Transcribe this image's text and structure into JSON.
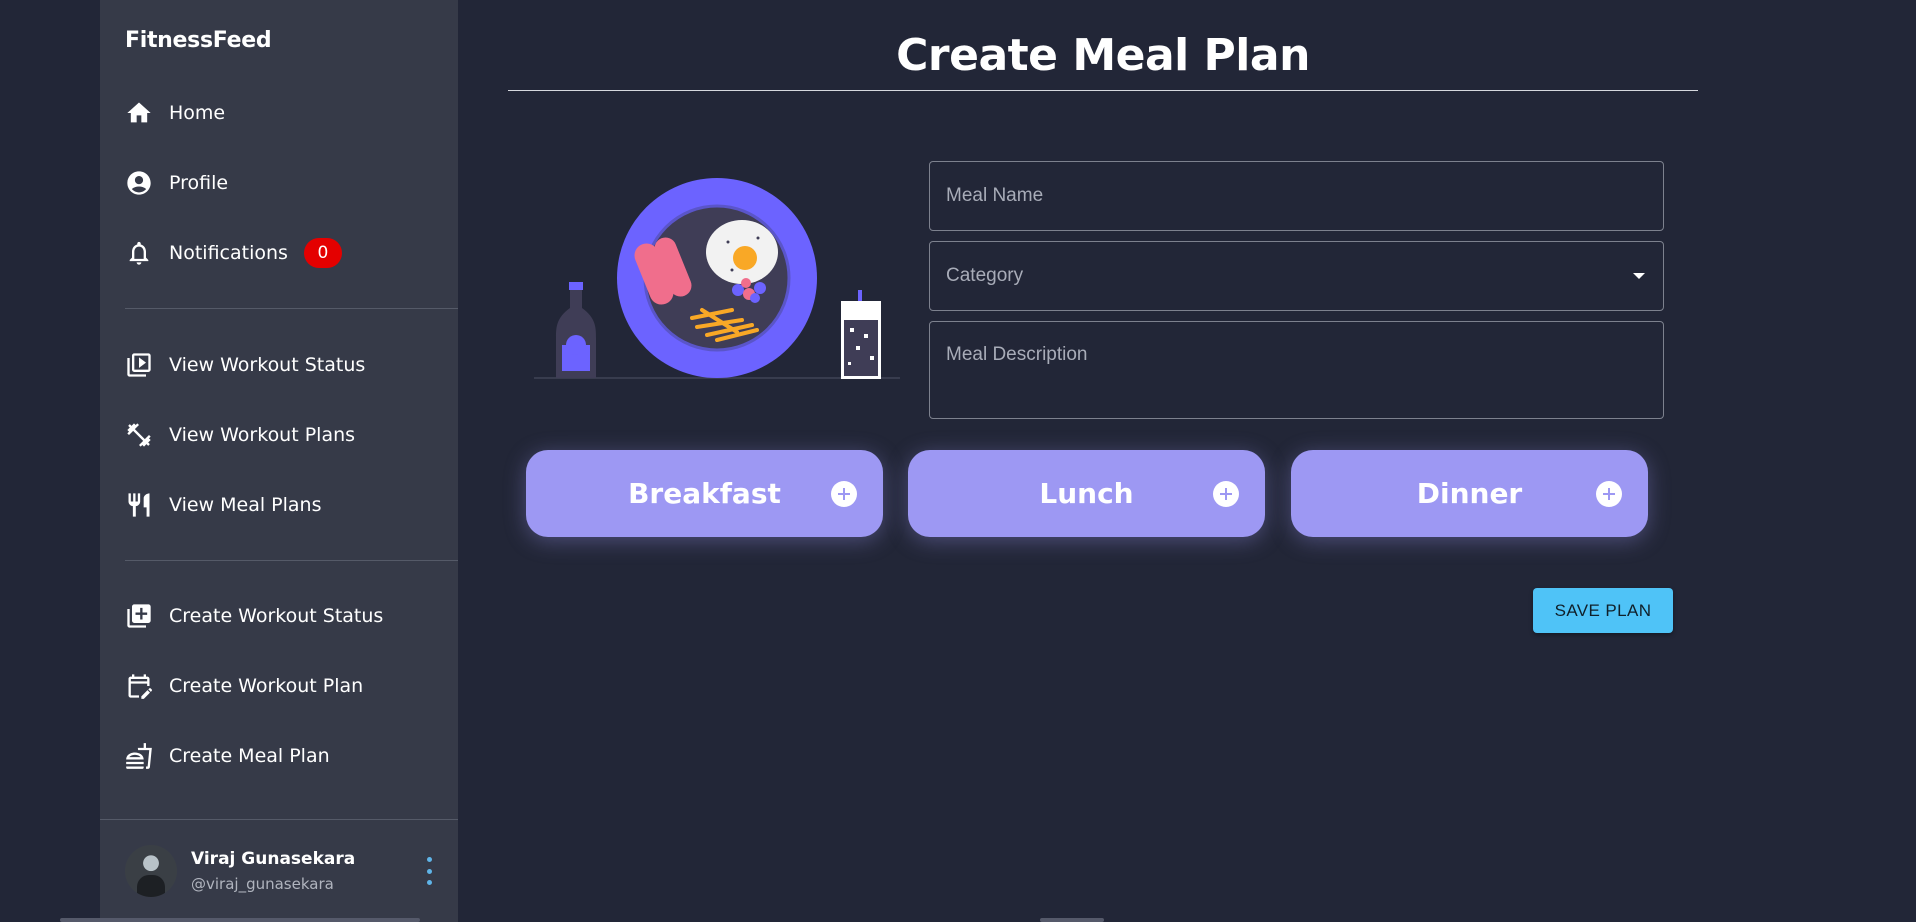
{
  "brand": "FitnessFeed",
  "nav": {
    "home": "Home",
    "profile": "Profile",
    "notifications": "Notifications",
    "notifications_count": "0",
    "view_workout_status": "View Workout Status",
    "view_workout_plans": "View Workout Plans",
    "view_meal_plans": "View Meal Plans",
    "create_workout_status": "Create Workout Status",
    "create_workout_plan": "Create Workout Plan",
    "create_meal_plan": "Create Meal Plan"
  },
  "user": {
    "name": "Viraj Gunasekara",
    "handle": "@viraj_gunasekara"
  },
  "page": {
    "title": "Create Meal Plan"
  },
  "form": {
    "meal_name_placeholder": "Meal Name",
    "meal_name_value": "",
    "category_placeholder": "Category",
    "description_placeholder": "Meal Description",
    "description_value": ""
  },
  "meals": {
    "breakfast": "Breakfast",
    "lunch": "Lunch",
    "dinner": "Dinner"
  },
  "actions": {
    "save": "SAVE PLAN"
  },
  "colors": {
    "background": "#222637",
    "sidebar": "#363a48",
    "meal_button": "#9d98f3",
    "save_button": "#4fc3f7",
    "badge": "#e40000",
    "accent_purple": "#6c63ff"
  },
  "icons": {
    "home": "home-icon",
    "profile": "account-circle-icon",
    "notifications": "bell-icon",
    "view_workout_status": "video-library-icon",
    "view_workout_plans": "dumbbell-icon",
    "view_meal_plans": "fork-knife-icon",
    "create_workout_status": "add-library-icon",
    "create_workout_plan": "calendar-edit-icon",
    "create_meal_plan": "food-icon",
    "meal_add": "plus-circle-icon",
    "user_menu": "more-vertical-icon"
  }
}
